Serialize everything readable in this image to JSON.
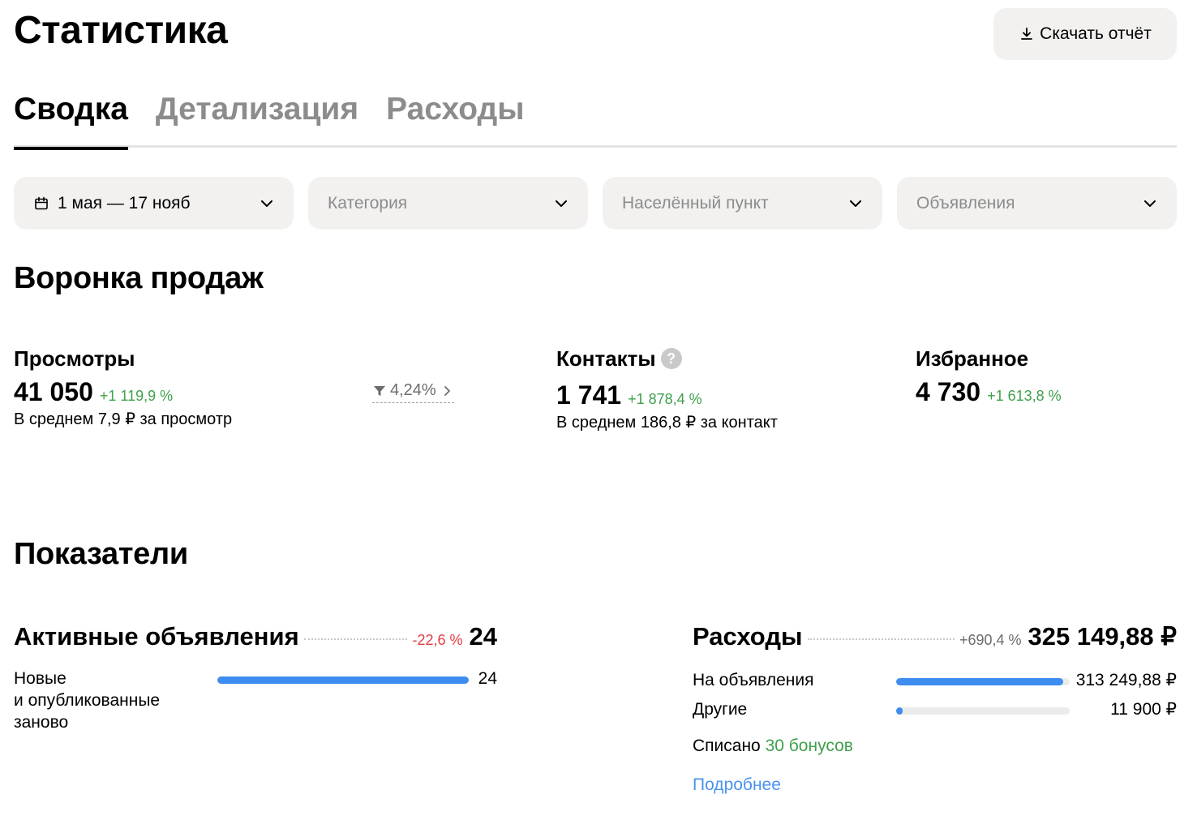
{
  "header": {
    "title": "Статистика",
    "download_label": "Скачать отчёт"
  },
  "tabs": [
    {
      "label": "Сводка",
      "active": true
    },
    {
      "label": "Детализация",
      "active": false
    },
    {
      "label": "Расходы",
      "active": false
    }
  ],
  "filters": {
    "date": "1 мая — 17 нояб",
    "category": "Категория",
    "city": "Населённый пункт",
    "ads": "Объявления"
  },
  "funnel": {
    "title": "Воронка продаж",
    "views": {
      "label": "Просмотры",
      "value": "41 050",
      "delta": "+1 119,9 %",
      "sub": "В среднем 7,9 ₽ за просмотр"
    },
    "conversion": "4,24%",
    "contacts": {
      "label": "Контакты",
      "value": "1 741",
      "delta": "+1 878,4 %",
      "sub": "В среднем 186,8 ₽ за контакт"
    },
    "favorites": {
      "label": "Избранное",
      "value": "4 730",
      "delta": "+1 613,8 %"
    }
  },
  "indicators": {
    "title": "Показатели",
    "active_ads": {
      "title": "Активные объявления",
      "delta": "-22,6 %",
      "value": "24",
      "rows": [
        {
          "label_lines": [
            "Новые",
            "и опубликованные",
            "заново"
          ],
          "value": "24",
          "fill": 1.0
        }
      ]
    },
    "expenses": {
      "title": "Расходы",
      "delta": "+690,4 %",
      "value": "325 149,88 ₽",
      "rows": [
        {
          "label": "На объявления",
          "value": "313 249,88 ₽",
          "fill": 0.9634
        },
        {
          "label": "Другие",
          "value": "11 900 ₽",
          "fill": 0.0366
        }
      ],
      "written_off_label": "Списано",
      "written_off_bonus": "30 бонусов",
      "more_link": "Подробнее"
    }
  },
  "colors": {
    "accent_blue": "#3d8cf0",
    "positive": "#3fa04b",
    "negative": "#e03c44",
    "link": "#4a93ee",
    "chip_bg": "#f2f1f0"
  }
}
